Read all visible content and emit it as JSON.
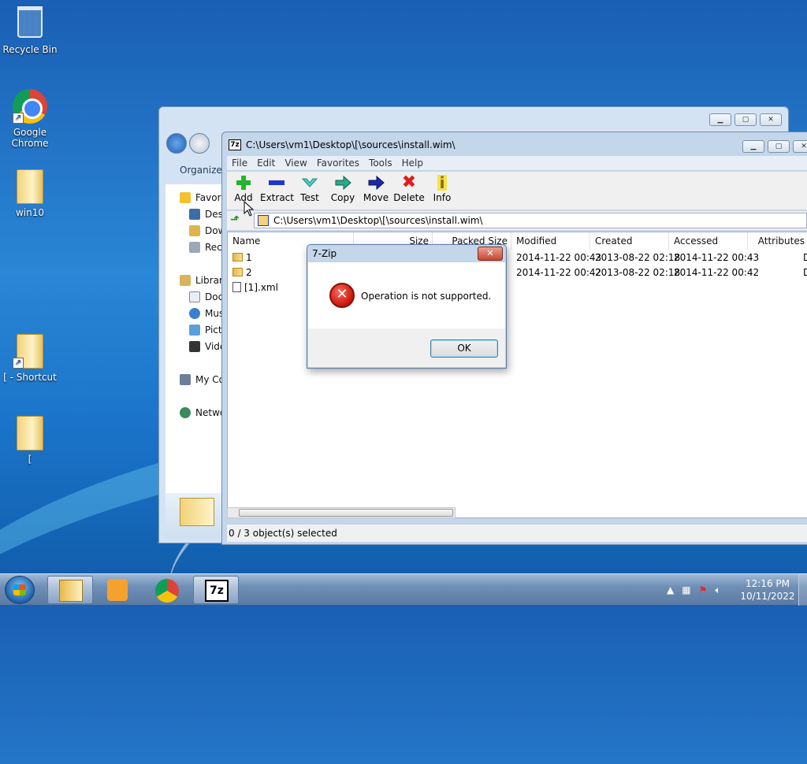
{
  "desktop": {
    "icons": [
      {
        "label": "Recycle Bin",
        "icon": "recycle-bin-icon"
      },
      {
        "label": "Google Chrome",
        "icon": "chrome-icon"
      },
      {
        "label": "win10",
        "icon": "folder-icon"
      },
      {
        "label": "[ - Shortcut",
        "icon": "folder-shortcut-icon"
      },
      {
        "label": "[",
        "icon": "folder-icon"
      }
    ]
  },
  "explorer": {
    "organize_label": "Organize",
    "sidebar": [
      {
        "label": "Favorites"
      },
      {
        "label": "Desktop"
      },
      {
        "label": "Downloads"
      },
      {
        "label": "Recent Places"
      },
      {
        "label": "Libraries"
      },
      {
        "label": "Documents"
      },
      {
        "label": "Music"
      },
      {
        "label": "Pictures"
      },
      {
        "label": "Videos"
      },
      {
        "label": "My Computer"
      },
      {
        "label": "Network"
      }
    ]
  },
  "zip": {
    "title": "C:\\Users\\vm1\\Desktop\\[\\sources\\install.wim\\",
    "menu": [
      "File",
      "Edit",
      "View",
      "Favorites",
      "Tools",
      "Help"
    ],
    "toolbar": [
      "Add",
      "Extract",
      "Test",
      "Copy",
      "Move",
      "Delete",
      "Info"
    ],
    "address": "C:\\Users\\vm1\\Desktop\\[\\sources\\install.wim\\",
    "columns": [
      "Name",
      "Size",
      "Packed Size",
      "Modified",
      "Created",
      "Accessed",
      "Attributes"
    ],
    "rows": [
      {
        "name": "1",
        "type": "folder",
        "modified": "2014-11-22 00:43",
        "created": "2013-08-22 02:18",
        "accessed": "2014-11-22 00:43",
        "attr": "D"
      },
      {
        "name": "2",
        "type": "folder",
        "modified": "2014-11-22 00:42",
        "created": "2013-08-22 02:18",
        "accessed": "2014-11-22 00:42",
        "attr": "D"
      },
      {
        "name": "[1].xml",
        "type": "file",
        "modified": "",
        "created": "",
        "accessed": "",
        "attr": ""
      }
    ],
    "status": "0 / 3 object(s) selected"
  },
  "dialog": {
    "title": "7-Zip",
    "message": "Operation is not supported.",
    "ok_label": "OK",
    "close_glyph": "✕"
  },
  "taskbar": {
    "time": "12:16 PM",
    "date": "10/11/2022"
  }
}
